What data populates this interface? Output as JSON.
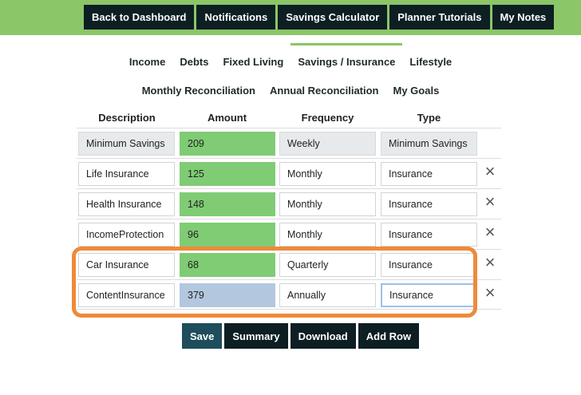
{
  "top_nav": [
    {
      "label": "Back to Dashboard"
    },
    {
      "label": "Notifications"
    },
    {
      "label": "Savings Calculator"
    },
    {
      "label": "Planner Tutorials"
    },
    {
      "label": "My Notes"
    }
  ],
  "tabs_row1": [
    {
      "label": "Income"
    },
    {
      "label": "Debts"
    },
    {
      "label": "Fixed Living"
    },
    {
      "label": "Savings / Insurance",
      "active": true
    },
    {
      "label": "Lifestyle"
    }
  ],
  "tabs_row2": [
    {
      "label": "Monthly Reconciliation"
    },
    {
      "label": "Annual Reconciliation"
    },
    {
      "label": "My Goals"
    }
  ],
  "table": {
    "headers": {
      "description": "Description",
      "amount": "Amount",
      "frequency": "Frequency",
      "type": "Type"
    },
    "rows": [
      {
        "description": "Minimum Savings",
        "amount": "209",
        "frequency": "Weekly",
        "type": "Minimum Savings"
      },
      {
        "description": "Life Insurance",
        "amount": "125",
        "frequency": "Monthly",
        "type": "Insurance"
      },
      {
        "description": "Health Insurance",
        "amount": "148",
        "frequency": "Monthly",
        "type": "Insurance"
      },
      {
        "description": "IncomeProtection",
        "amount": "96",
        "frequency": "Monthly",
        "type": "Insurance"
      },
      {
        "description": "Car Insurance",
        "amount": "68",
        "frequency": "Quarterly",
        "type": "Insurance"
      },
      {
        "description": "ContentInsurance",
        "amount": "379",
        "frequency": "Annually",
        "type": "Insurance"
      }
    ]
  },
  "actions": {
    "save": "Save",
    "summary": "Summary",
    "download": "Download",
    "add_row": "Add Row"
  },
  "colors": {
    "brand_green": "#8bc668",
    "amount_green": "#7fcc75",
    "amount_blue": "#b3c7de",
    "dark_button": "#0d1f22",
    "save_button": "#1e4d5c",
    "highlight_orange": "#ee8a3a"
  },
  "icons": {
    "delete": "close-x-icon"
  }
}
